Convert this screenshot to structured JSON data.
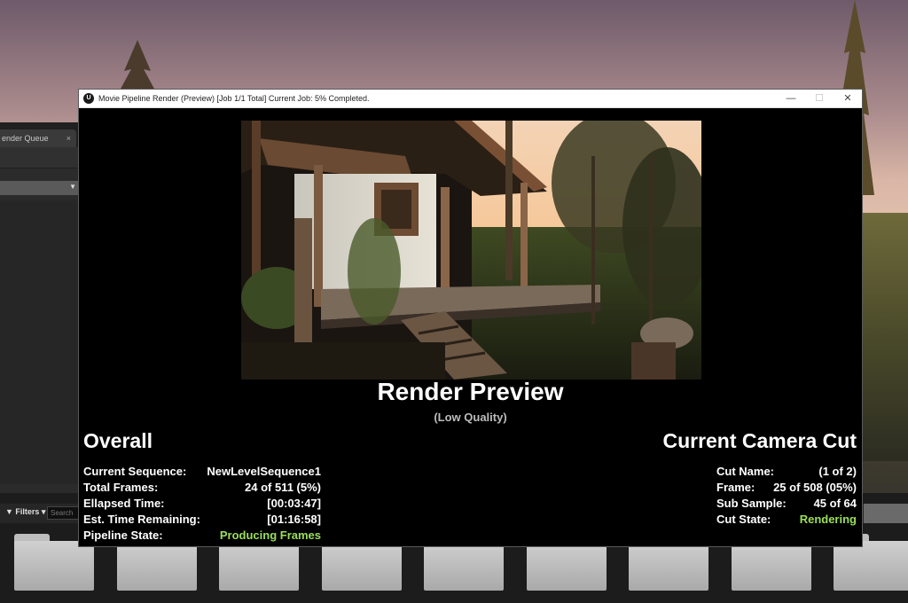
{
  "window": {
    "title": "Movie Pipeline Render (Preview) [Job 1/1 Total] Current Job: 5% Completed.",
    "logo": "U",
    "minimize_glyph": "—",
    "maximize_glyph": "☐",
    "close_glyph": "✕"
  },
  "editor": {
    "tab_label": "ender Queue",
    "tab_close": "×"
  },
  "content_browser": {
    "filters_label": "▼ Filters ▾",
    "search_placeholder": "Search",
    "folder_count": 9
  },
  "preview": {
    "title": "Render Preview",
    "subtitle": "(Low Quality)"
  },
  "overall": {
    "heading": "Overall",
    "rows": [
      {
        "label": "Current Sequence:",
        "value": "NewLevelSequence1"
      },
      {
        "label": "Total Frames:",
        "value": "24 of 511 (5%)"
      },
      {
        "label": "Ellapsed Time:",
        "value": "[00:03:47]"
      },
      {
        "label": "Est. Time Remaining:",
        "value": "[01:16:58]"
      },
      {
        "label": "Pipeline State:",
        "value": "Producing Frames"
      }
    ]
  },
  "camera_cut": {
    "heading": "Current Camera Cut",
    "rows": [
      {
        "label": "Cut Name:",
        "value": "(1 of 2)"
      },
      {
        "label": "Frame:",
        "value": "25 of 508 (05%)"
      },
      {
        "label": "Sub Sample:",
        "value": "45 of 64"
      },
      {
        "label": "Cut State:",
        "value": "Rendering"
      }
    ]
  },
  "colors": {
    "status_green": "#9bde5a",
    "window_bg": "#000000"
  }
}
